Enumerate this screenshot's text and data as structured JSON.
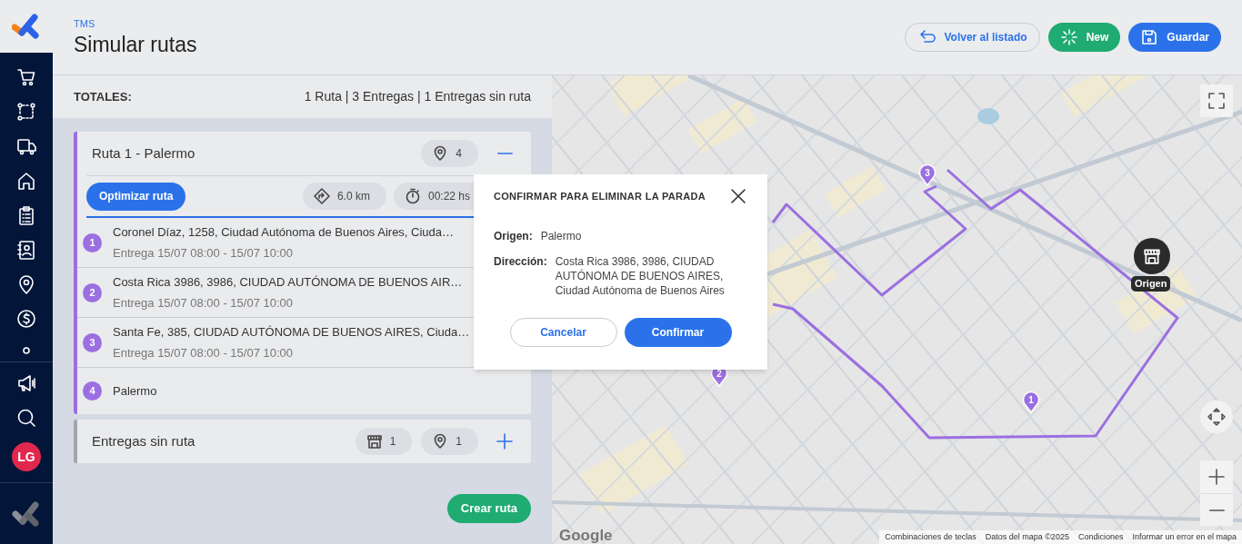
{
  "header": {
    "breadcrumb": "TMS",
    "title": "Simular rutas",
    "buttons": [
      {
        "label": "Volver al listado",
        "kind": "back"
      },
      {
        "label": "New",
        "kind": "new"
      },
      {
        "label": "Guardar",
        "kind": "save"
      }
    ]
  },
  "user": {
    "initials": "LG"
  },
  "totals": {
    "label": "TOTALES:",
    "summary": "1 Ruta | 3 Entregas | 1 Entregas sin ruta"
  },
  "groups": [
    {
      "kind": "route",
      "name": "Ruta 1 - Palermo",
      "expanded": true,
      "stops_count": "4",
      "optimize_button": "Optimizar ruta",
      "distance": "6.0 km",
      "duration": "00:22 hs",
      "stops": [
        {
          "number": "1",
          "address": "Coronel Díaz, 1258, Ciudad Autónoma de Buenos Aires, Ciuda…",
          "window": "Entrega 15/07 08:00 - 15/07 10:00"
        },
        {
          "number": "2",
          "address": "Costa Rica 3986, 3986, CIUDAD AUTÓNOMA DE BUENOS AIR…",
          "window": "Entrega 15/07 08:00 - 15/07 10:00"
        },
        {
          "number": "3",
          "address": "Santa Fe, 385, CIUDAD AUTÓNOMA DE BUENOS AIRES, Ciuda…",
          "window": "Entrega 15/07 08:00 - 15/07 10:00"
        },
        {
          "number": "4",
          "address": "Palermo"
        }
      ]
    },
    {
      "kind": "unrouted",
      "name": "Entregas sin ruta",
      "expanded": false,
      "warehouse_count": "1",
      "stops_count": "1"
    }
  ],
  "create_button": "Crear ruta",
  "map": {
    "markers": [
      {
        "number": "1"
      },
      {
        "number": "2"
      },
      {
        "number": "3"
      }
    ],
    "origin_label": "Origen",
    "logo": "Google",
    "attribution": [
      "Combinaciones de teclas",
      "Datos del mapa ©2025",
      "Condiciones",
      "Informar un error en el mapa"
    ]
  },
  "dialog": {
    "title": "CONFIRMAR PARA ELIMINAR LA PARADA",
    "fields": [
      {
        "label": "Origen:",
        "value": "Palermo"
      },
      {
        "label": "Dirección:",
        "value": "Costa Rica 3986, 3986, CIUDAD AUTÓNOMA DE BUENOS AIRES, Ciudad Autónoma de Buenos Aires"
      }
    ],
    "buttons": [
      {
        "label": "Cancelar",
        "kind": "secondary"
      },
      {
        "label": "Confirmar",
        "kind": "primary"
      }
    ]
  }
}
